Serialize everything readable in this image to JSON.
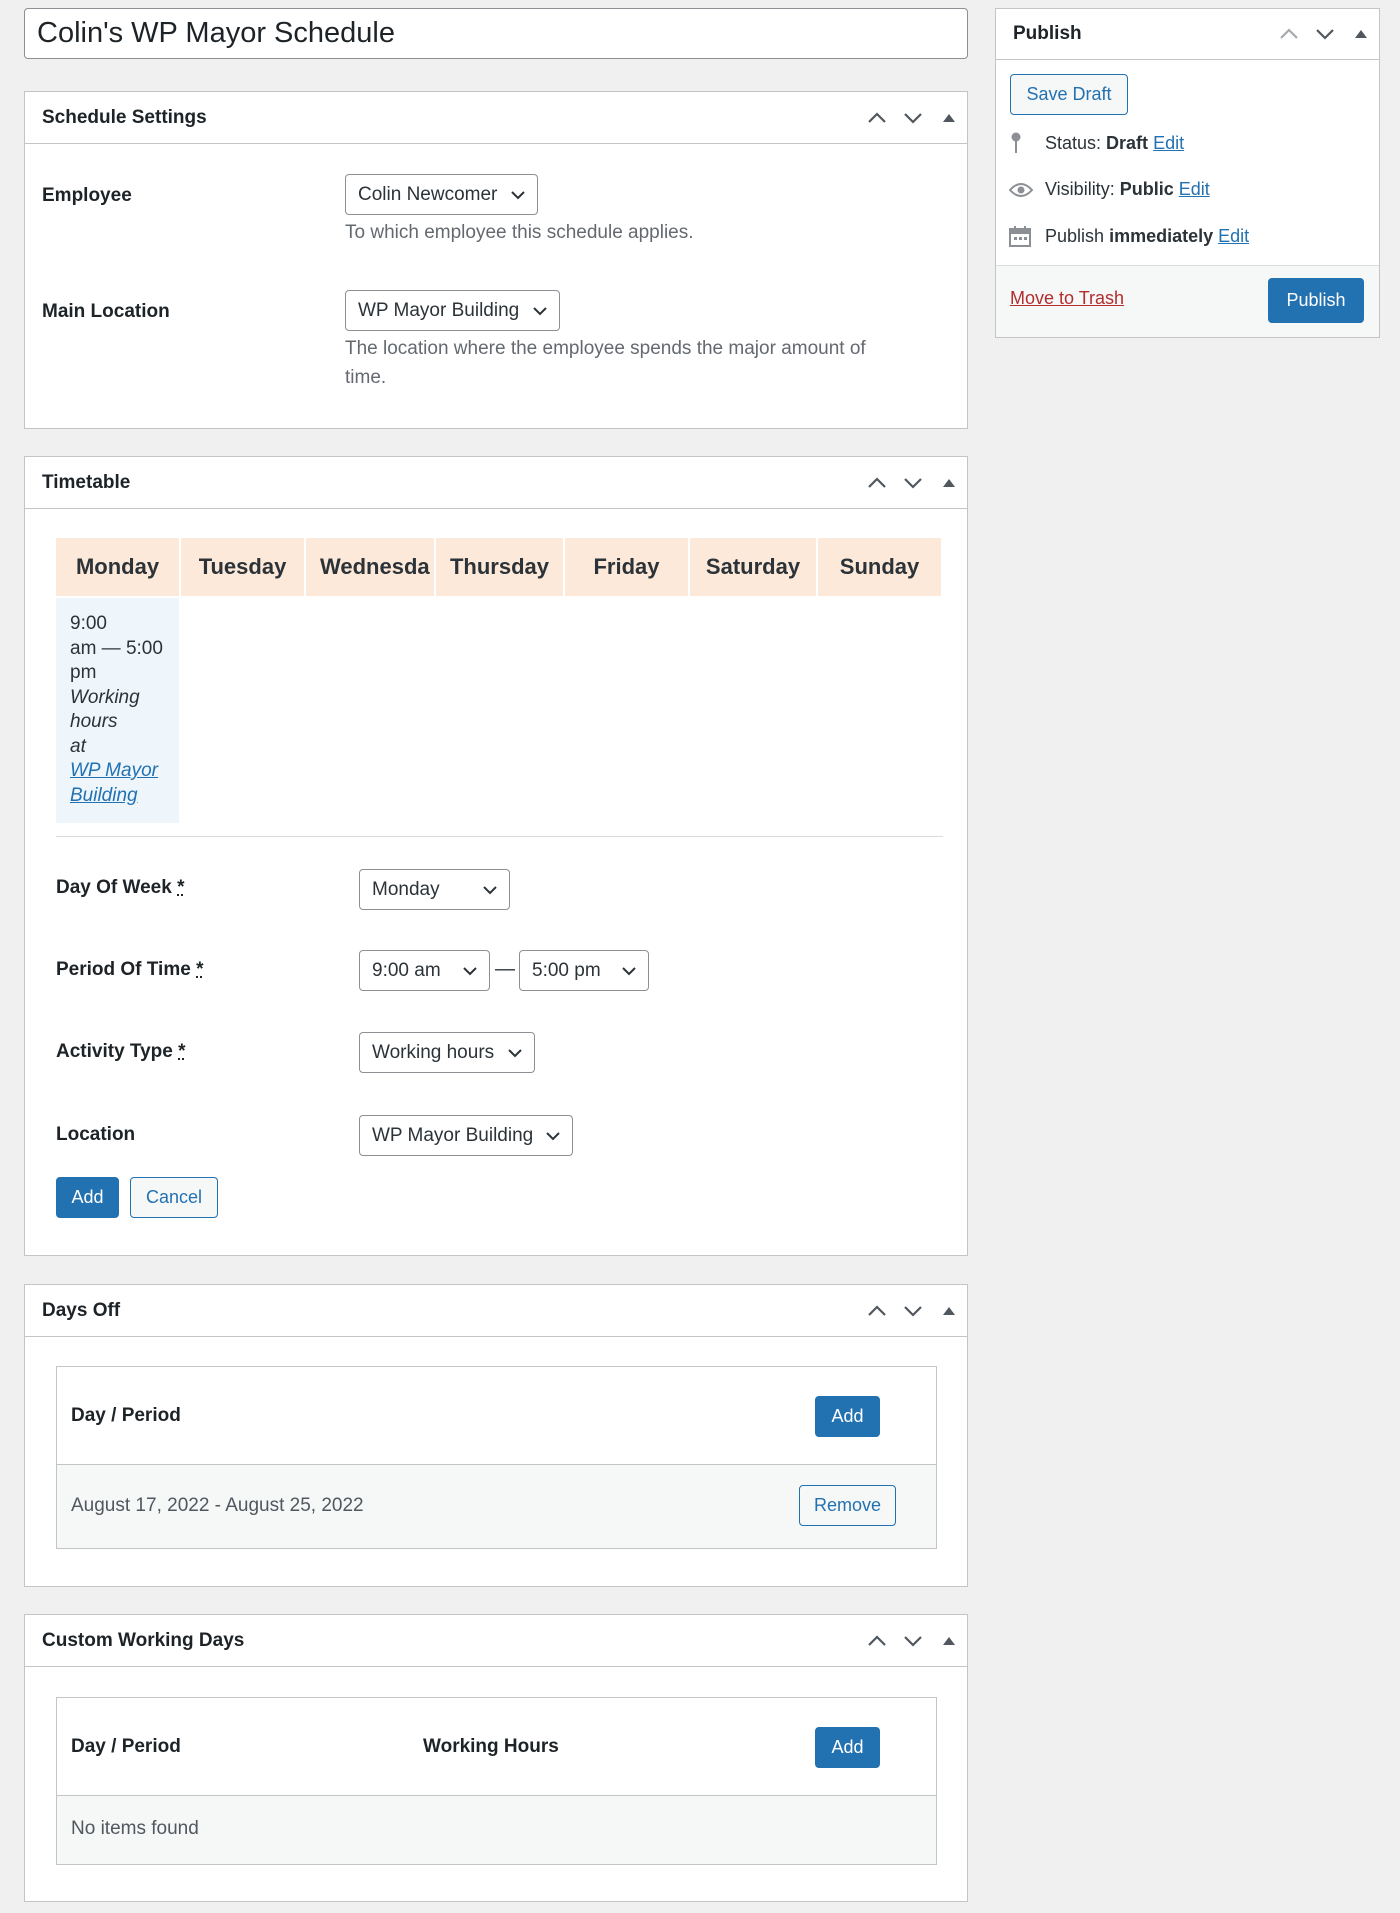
{
  "post_title": "Colin's WP Mayor Schedule",
  "schedule_settings": {
    "title": "Schedule Settings",
    "employee_label": "Employee",
    "employee_value": "Colin Newcomer",
    "employee_desc": "To which employee this schedule applies.",
    "location_label": "Main Location",
    "location_value": "WP Mayor Building",
    "location_desc_1": "The location where the employee spends the major amount of",
    "location_desc_2": "time."
  },
  "timetable": {
    "title": "Timetable",
    "days": [
      "Monday",
      "Tuesday",
      "Wednesda",
      "Thursday",
      "Friday",
      "Saturday",
      "Sunday"
    ],
    "slot": {
      "time_1": "9:00",
      "time_2": "am — 5:00",
      "time_3": "pm",
      "activity_1": "Working",
      "activity_2": "hours",
      "at": "at",
      "loc_1": "WP Mayor",
      "loc_2": "Building"
    },
    "form": {
      "day_label": "Day Of Week",
      "day_value": "Monday",
      "period_label": "Period Of Time",
      "period_start": "9:00 am",
      "period_sep": "—",
      "period_end": "5:00 pm",
      "activity_label": "Activity Type",
      "activity_value": "Working hours",
      "location_label": "Location",
      "location_value": "WP Mayor Building",
      "required_mark": "*",
      "add": "Add",
      "cancel": "Cancel"
    }
  },
  "days_off": {
    "title": "Days Off",
    "col_period": "Day / Period",
    "add": "Add",
    "rows": [
      {
        "period": "August 17, 2022 - August 25, 2022",
        "remove": "Remove"
      }
    ]
  },
  "custom_days": {
    "title": "Custom Working Days",
    "col_period": "Day / Period",
    "col_hours": "Working Hours",
    "add": "Add",
    "empty": "No items found"
  },
  "publish": {
    "title": "Publish",
    "save_draft": "Save Draft",
    "status_label": "Status:",
    "status_value": "Draft",
    "visibility_label": "Visibility:",
    "visibility_value": "Public",
    "publish_label": "Publish",
    "publish_value": "immediately",
    "edit": "Edit",
    "trash": "Move to Trash",
    "publish_button": "Publish"
  },
  "colors": {
    "accent": "#2271b1",
    "day_header_bg": "#fde9d9",
    "slot_bg": "#eef6fc",
    "trash": "#b32d2e"
  }
}
